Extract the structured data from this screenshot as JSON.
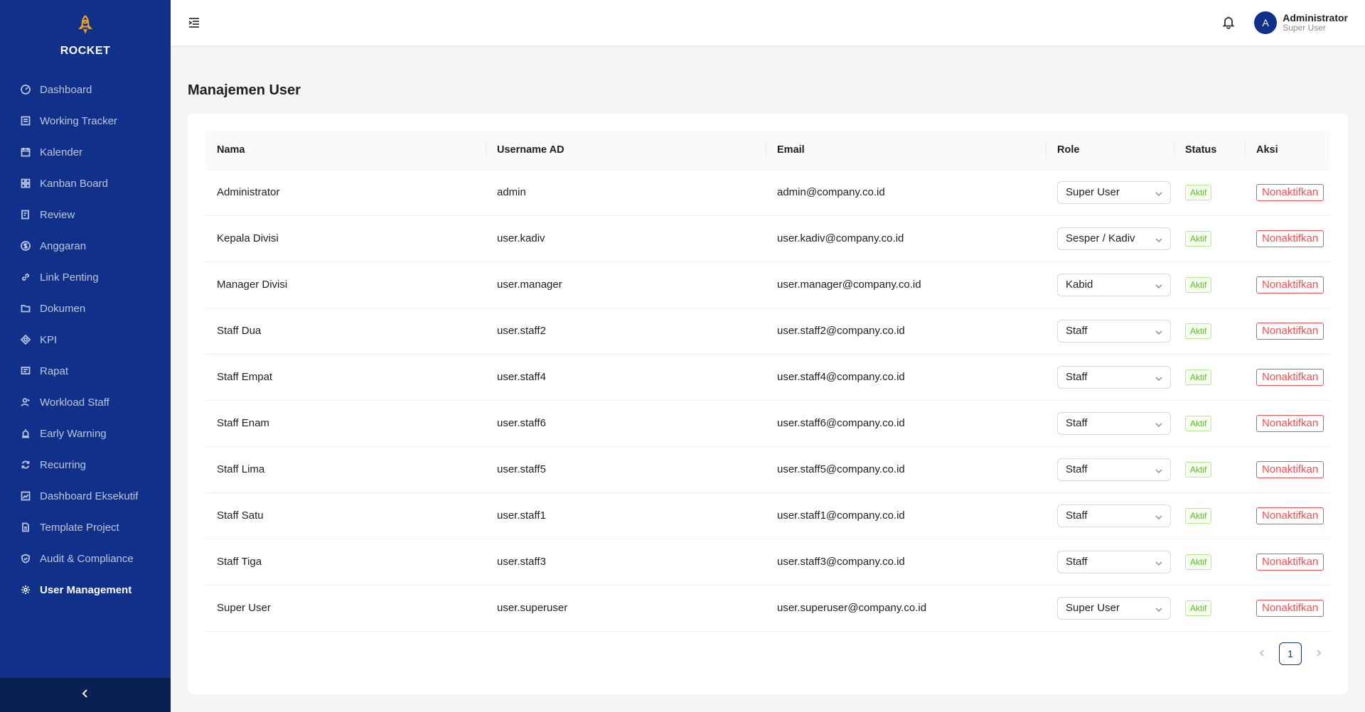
{
  "app": {
    "brand": "ROCKET"
  },
  "sidebar": {
    "items": [
      {
        "label": "Dashboard",
        "icon": "dashboard-icon",
        "active": false
      },
      {
        "label": "Working Tracker",
        "icon": "tracker-icon",
        "active": false
      },
      {
        "label": "Kalender",
        "icon": "calendar-icon",
        "active": false
      },
      {
        "label": "Kanban Board",
        "icon": "kanban-icon",
        "active": false
      },
      {
        "label": "Review",
        "icon": "review-icon",
        "active": false
      },
      {
        "label": "Anggaran",
        "icon": "dollar-icon",
        "active": false
      },
      {
        "label": "Link Penting",
        "icon": "link-icon",
        "active": false
      },
      {
        "label": "Dokumen",
        "icon": "folder-icon",
        "active": false
      },
      {
        "label": "KPI",
        "icon": "target-icon",
        "active": false
      },
      {
        "label": "Rapat",
        "icon": "meeting-icon",
        "active": false
      },
      {
        "label": "Workload Staff",
        "icon": "team-icon",
        "active": false
      },
      {
        "label": "Early Warning",
        "icon": "alert-icon",
        "active": false
      },
      {
        "label": "Recurring",
        "icon": "sync-icon",
        "active": false
      },
      {
        "label": "Dashboard Eksekutif",
        "icon": "chart-icon",
        "active": false
      },
      {
        "label": "Template Project",
        "icon": "file-icon",
        "active": false
      },
      {
        "label": "Audit & Compliance",
        "icon": "shield-check-icon",
        "active": false
      },
      {
        "label": "User Management",
        "icon": "gear-icon",
        "active": true
      }
    ]
  },
  "header": {
    "user_initial": "A",
    "user_name": "Administrator",
    "user_role": "Super User"
  },
  "page": {
    "title": "Manajemen User"
  },
  "table": {
    "columns": [
      "Nama",
      "Username AD",
      "Email",
      "Role",
      "Status",
      "Aksi"
    ],
    "rows": [
      {
        "nama": "Administrator",
        "username": "admin",
        "email": "admin@company.co.id",
        "role": "Super User",
        "status": "Aktif",
        "action": "Nonaktifkan"
      },
      {
        "nama": "Kepala Divisi",
        "username": "user.kadiv",
        "email": "user.kadiv@company.co.id",
        "role": "Sesper / Kadiv",
        "status": "Aktif",
        "action": "Nonaktifkan"
      },
      {
        "nama": "Manager Divisi",
        "username": "user.manager",
        "email": "user.manager@company.co.id",
        "role": "Kabid",
        "status": "Aktif",
        "action": "Nonaktifkan"
      },
      {
        "nama": "Staff Dua",
        "username": "user.staff2",
        "email": "user.staff2@company.co.id",
        "role": "Staff",
        "status": "Aktif",
        "action": "Nonaktifkan"
      },
      {
        "nama": "Staff Empat",
        "username": "user.staff4",
        "email": "user.staff4@company.co.id",
        "role": "Staff",
        "status": "Aktif",
        "action": "Nonaktifkan"
      },
      {
        "nama": "Staff Enam",
        "username": "user.staff6",
        "email": "user.staff6@company.co.id",
        "role": "Staff",
        "status": "Aktif",
        "action": "Nonaktifkan"
      },
      {
        "nama": "Staff Lima",
        "username": "user.staff5",
        "email": "user.staff5@company.co.id",
        "role": "Staff",
        "status": "Aktif",
        "action": "Nonaktifkan"
      },
      {
        "nama": "Staff Satu",
        "username": "user.staff1",
        "email": "user.staff1@company.co.id",
        "role": "Staff",
        "status": "Aktif",
        "action": "Nonaktifkan"
      },
      {
        "nama": "Staff Tiga",
        "username": "user.staff3",
        "email": "user.staff3@company.co.id",
        "role": "Staff",
        "status": "Aktif",
        "action": "Nonaktifkan"
      },
      {
        "nama": "Super User",
        "username": "user.superuser",
        "email": "user.superuser@company.co.id",
        "role": "Super User",
        "status": "Aktif",
        "action": "Nonaktifkan"
      }
    ]
  },
  "pagination": {
    "current_page": "1"
  },
  "colors": {
    "sidebar_bg": "#10308a",
    "sidebar_footer_bg": "#0a1f52",
    "brand_icon": "#f5a623",
    "status_green": "#52c41a",
    "danger_red": "#ff4d4f"
  }
}
